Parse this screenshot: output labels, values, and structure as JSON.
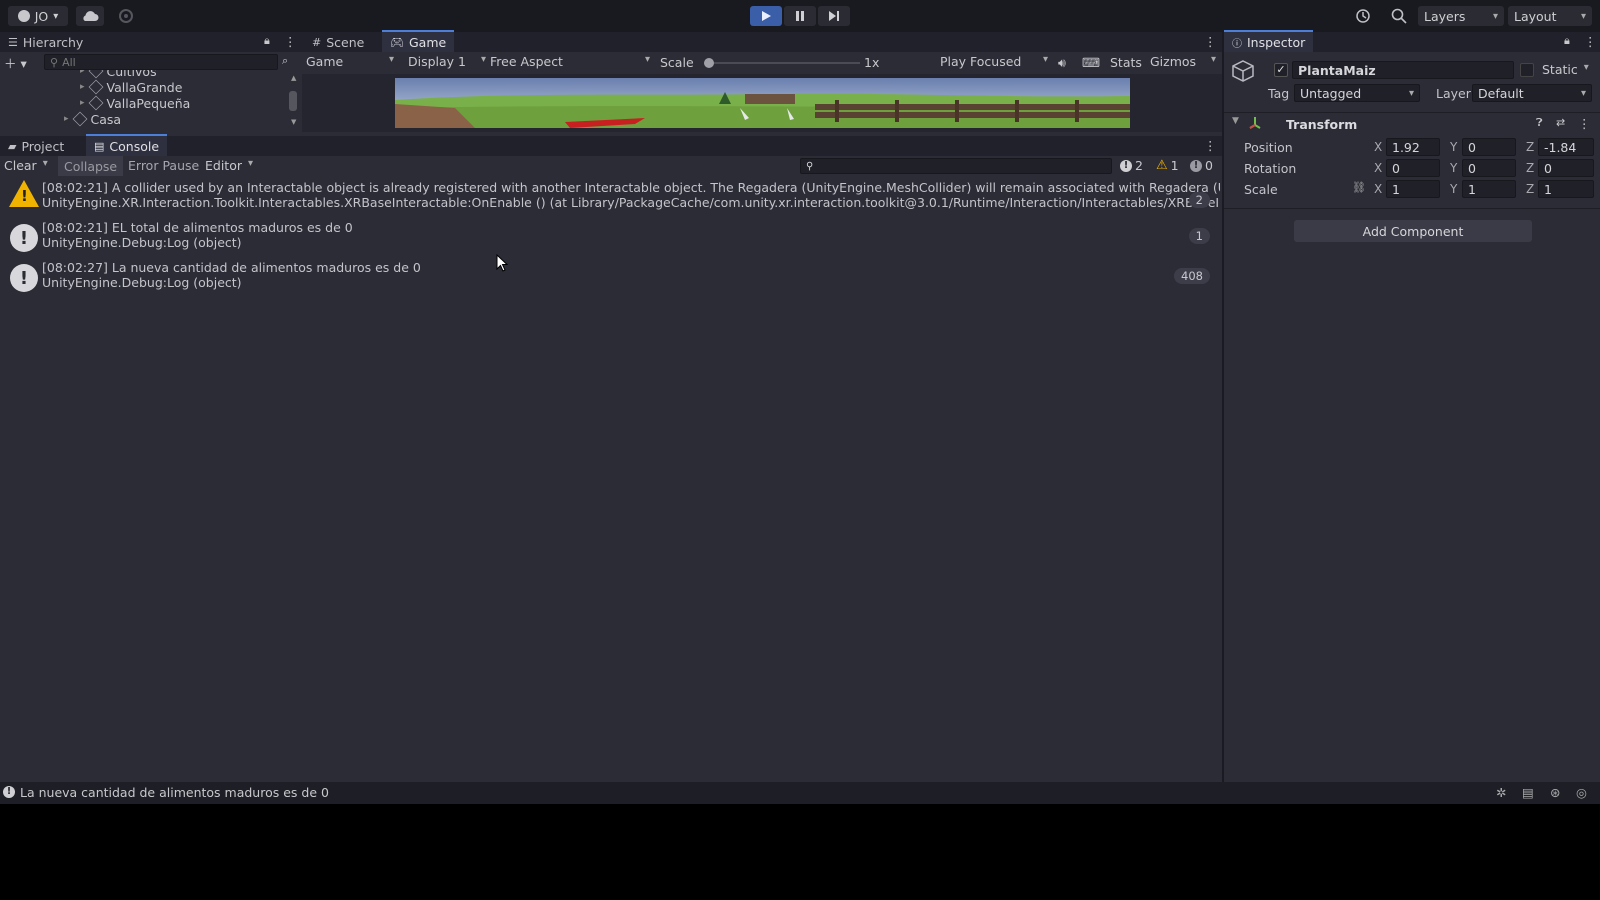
{
  "toolbar": {
    "account": "JO",
    "layers": "Layers",
    "layout": "Layout"
  },
  "hierarchy": {
    "title": "Hierarchy",
    "search_placeholder": "All",
    "items": [
      "Cultivos",
      "VallaGrande",
      "VallaPequeña",
      "Casa"
    ]
  },
  "game": {
    "tabs": [
      "Scene",
      "Game"
    ],
    "view": "Game",
    "display": "Display 1",
    "aspect": "Free Aspect",
    "scale_label": "Scale",
    "scale_value": "1x",
    "play_mode": "Play Focused",
    "stats": "Stats",
    "gizmos": "Gizmos"
  },
  "console": {
    "tabs": [
      "Project",
      "Console"
    ],
    "clear": "Clear",
    "collapse": "Collapse",
    "error_pause": "Error Pause",
    "editor": "Editor",
    "log_count": "2",
    "warn_count": "1",
    "error_count": "0",
    "messages": [
      {
        "type": "warning",
        "line1": "[08:02:21] A collider used by an Interactable object is already registered with another Interactable object. The Regadera (UnityEngine.MeshCollider) will remain associated with Regadera (UnityEngine",
        "line2": "UnityEngine.XR.Interaction.Toolkit.Interactables.XRBaseInteractable:OnEnable () (at Library/PackageCache/com.unity.xr.interaction.toolkit@3.0.1/Runtime/Interaction/Interactables/XRBaseInteractable.cs",
        "count": "2"
      },
      {
        "type": "log",
        "line1": "[08:02:21] EL total de alimentos maduros es de 0",
        "line2": "UnityEngine.Debug:Log (object)",
        "count": "1"
      },
      {
        "type": "log",
        "line1": "[08:02:27] La nueva cantidad de alimentos maduros es de 0",
        "line2": "UnityEngine.Debug:Log (object)",
        "count": "408"
      }
    ]
  },
  "inspector": {
    "title": "Inspector",
    "object_name": "PlantaMaiz",
    "static_label": "Static",
    "tag_label": "Tag",
    "tag_value": "Untagged",
    "layer_label": "Layer",
    "layer_value": "Default",
    "component": "Transform",
    "position_label": "Position",
    "rotation_label": "Rotation",
    "scale_label": "Scale",
    "axes": [
      "X",
      "Y",
      "Z"
    ],
    "position": [
      "1.92",
      "0",
      "-1.84"
    ],
    "rotation": [
      "0",
      "0",
      "0"
    ],
    "scale": [
      "1",
      "1",
      "1"
    ],
    "add_component": "Add Component"
  },
  "status_bar": {
    "message": "La nueva cantidad de alimentos maduros es de 0"
  }
}
